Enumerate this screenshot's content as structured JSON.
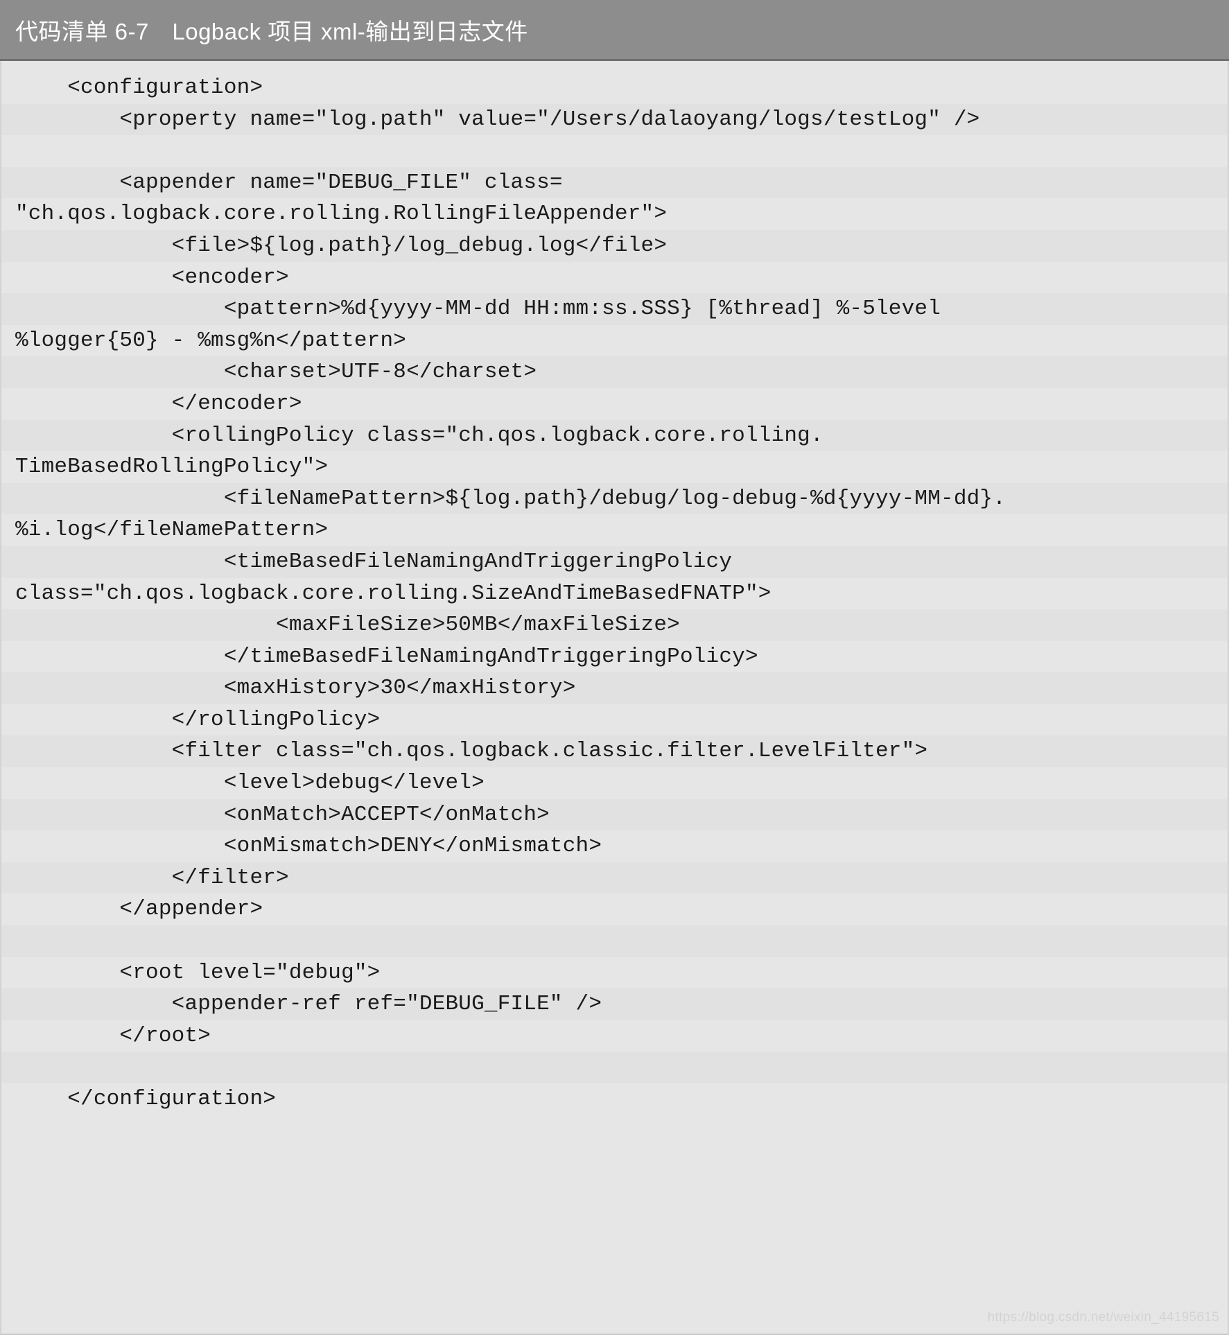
{
  "caption": {
    "label": "代码清单 6-7　Logback 项目 xml-输出到日志文件"
  },
  "colors": {
    "header_background": "#8d8d8d",
    "header_text": "#ffffff",
    "code_background": "#e6e6e6",
    "code_stripe": "#e1e1e1",
    "code_text": "#1a1a1a",
    "watermark_text": "#d3d3d3"
  },
  "code": {
    "language": "xml",
    "lines": [
      "    <configuration>",
      "        <property name=\"log.path\" value=\"/Users/dalaoyang/logs/testLog\" />",
      "",
      "        <appender name=\"DEBUG_FILE\" class=",
      "\"ch.qos.logback.core.rolling.RollingFileAppender\">",
      "            <file>${log.path}/log_debug.log</file>",
      "            <encoder>",
      "                <pattern>%d{yyyy-MM-dd HH:mm:ss.SSS} [%thread] %-5level",
      "%logger{50} - %msg%n</pattern>",
      "                <charset>UTF-8</charset>",
      "            </encoder>",
      "            <rollingPolicy class=\"ch.qos.logback.core.rolling.",
      "TimeBasedRollingPolicy\">",
      "                <fileNamePattern>${log.path}/debug/log-debug-%d{yyyy-MM-dd}.",
      "%i.log</fileNamePattern>",
      "                <timeBasedFileNamingAndTriggeringPolicy",
      "class=\"ch.qos.logback.core.rolling.SizeAndTimeBasedFNATP\">",
      "                    <maxFileSize>50MB</maxFileSize>",
      "                </timeBasedFileNamingAndTriggeringPolicy>",
      "                <maxHistory>30</maxHistory>",
      "            </rollingPolicy>",
      "            <filter class=\"ch.qos.logback.classic.filter.LevelFilter\">",
      "                <level>debug</level>",
      "                <onMatch>ACCEPT</onMatch>",
      "                <onMismatch>DENY</onMismatch>",
      "            </filter>",
      "        </appender>",
      "",
      "        <root level=\"debug\">",
      "            <appender-ref ref=\"DEBUG_FILE\" />",
      "        </root>",
      "",
      "    </configuration>"
    ],
    "stripe_rows": [
      1,
      3,
      5,
      7,
      9,
      11,
      13,
      15,
      17,
      19,
      21,
      23,
      25,
      27,
      29,
      31
    ]
  },
  "watermark": {
    "text": "https://blog.csdn.net/weixin_44195615"
  }
}
